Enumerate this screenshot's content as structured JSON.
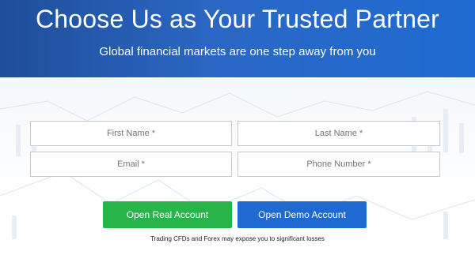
{
  "hero": {
    "title": "Choose Us as Your Trusted Partner",
    "subtitle": "Global financial markets are one step away from you"
  },
  "form": {
    "first_name_placeholder": "First Name *",
    "last_name_placeholder": "Last Name *",
    "email_placeholder": "Email *",
    "phone_placeholder": "Phone Number *"
  },
  "actions": {
    "open_real_label": "Open Real Account",
    "open_demo_label": "Open Demo Account"
  },
  "footer": {
    "disclaimer": "Trading CFDs and Forex may expose you to significant losses"
  },
  "colors": {
    "hero_blue": "#1f4e9a",
    "real_green": "#27b54a",
    "demo_blue": "#1f69d3"
  }
}
